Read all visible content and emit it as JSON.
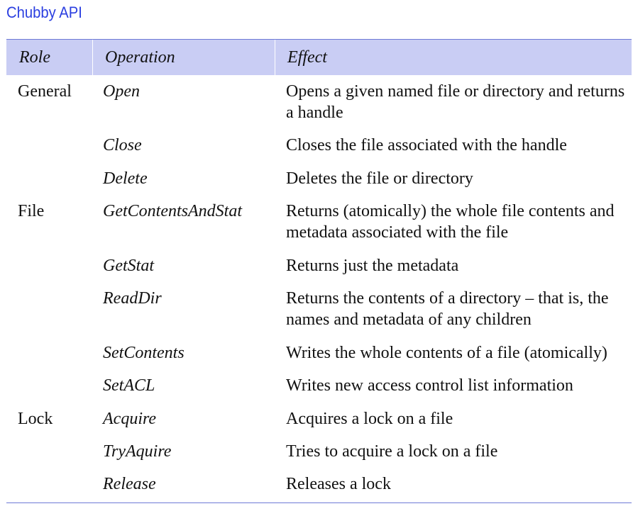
{
  "title": "Chubby API",
  "table": {
    "headers": [
      "Role",
      "Operation",
      "Effect"
    ],
    "rows": [
      {
        "role": "General",
        "operation": "Open",
        "effect": "Opens a given named file or directory and returns a handle"
      },
      {
        "role": "",
        "operation": "Close",
        "effect": "Closes the file associated with the handle"
      },
      {
        "role": "",
        "operation": "Delete",
        "effect": "Deletes the file or directory"
      },
      {
        "role": "File",
        "operation": "GetContentsAndStat",
        "effect": "Returns (atomically) the whole file contents and metadata associated with the file"
      },
      {
        "role": "",
        "operation": "GetStat",
        "effect": "Returns just the metadata"
      },
      {
        "role": "",
        "operation": "ReadDir",
        "effect": "Returns the contents of a directory – that is, the names and metadata of any children"
      },
      {
        "role": "",
        "operation": "SetContents",
        "effect": "Writes the whole contents of a file (atomically)"
      },
      {
        "role": "",
        "operation": "SetACL",
        "effect": "Writes new access control list information"
      },
      {
        "role": "Lock",
        "operation": "Acquire",
        "effect": "Acquires a lock on a file"
      },
      {
        "role": "",
        "operation": "TryAquire",
        "effect": "Tries to acquire a lock on a file"
      },
      {
        "role": "",
        "operation": "Release",
        "effect": "Releases a lock"
      }
    ]
  }
}
